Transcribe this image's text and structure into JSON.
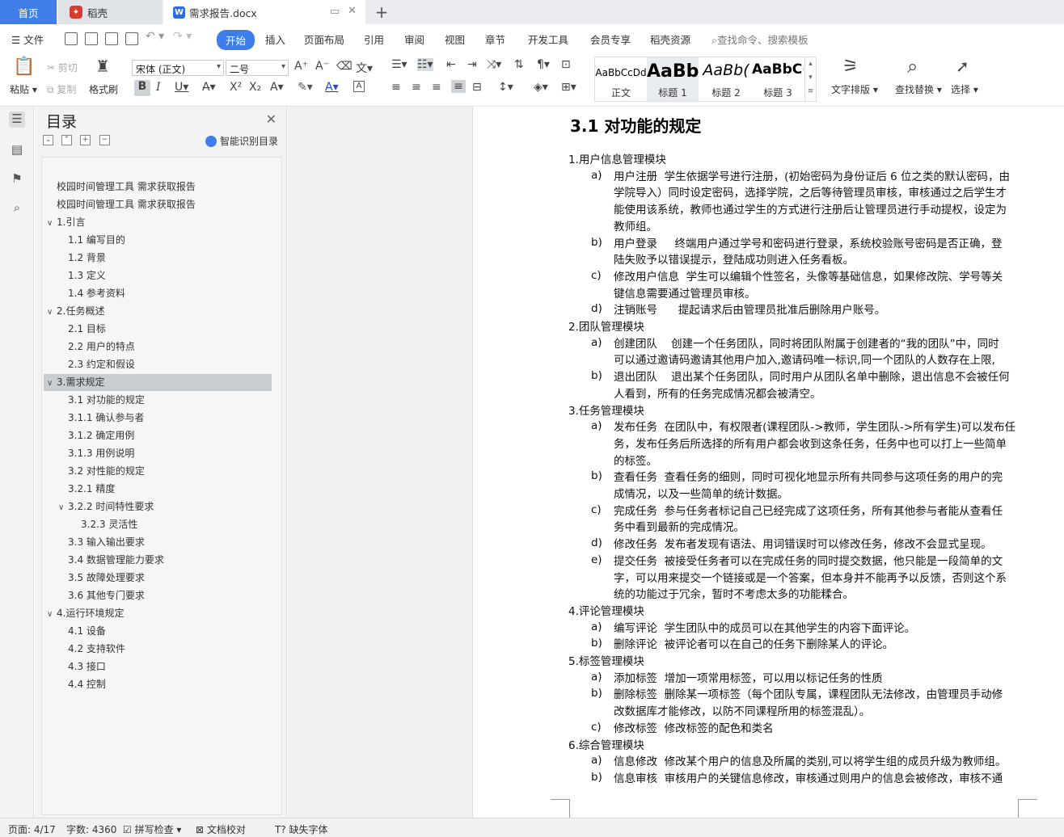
{
  "tabs": {
    "home": "首页",
    "daoke": "稻壳",
    "doc": "需求报告.docx",
    "add": "+"
  },
  "menu": {
    "file": "文件",
    "items": [
      "开始",
      "插入",
      "页面布局",
      "引用",
      "审阅",
      "视图",
      "章节",
      "开发工具",
      "会员专享",
      "稻壳资源"
    ],
    "search_placeholder": "查找命令、搜索模板"
  },
  "ribbon": {
    "paste": "粘贴",
    "cut": "剪切",
    "copy": "复制",
    "format_painter": "格式刷",
    "font_name": "宋体 (正文)",
    "font_size": "二号",
    "styles": [
      {
        "preview": "AaBbCcDd",
        "label": "正文"
      },
      {
        "preview": "AaBb",
        "label": "标题 1"
      },
      {
        "preview": "AaBb(",
        "label": "标题 2"
      },
      {
        "preview": "AaBbC(",
        "label": "标题 3"
      }
    ],
    "text_layout": "文字排版",
    "find_replace": "查找替换",
    "select": "选择"
  },
  "toc": {
    "title": "目录",
    "ai_label": "智能识别目录",
    "items": [
      {
        "text": "校园时间管理工具  需求获取报告",
        "level": 0,
        "caret": ""
      },
      {
        "text": "校园时间管理工具  需求获取报告",
        "level": 0,
        "caret": ""
      },
      {
        "text": "1.引言",
        "level": 0,
        "caret": "∨"
      },
      {
        "text": "1.1  编写目的",
        "level": 1,
        "caret": ""
      },
      {
        "text": "1.2  背景",
        "level": 1,
        "caret": ""
      },
      {
        "text": "1.3  定义",
        "level": 1,
        "caret": ""
      },
      {
        "text": "1.4  参考资料",
        "level": 1,
        "caret": ""
      },
      {
        "text": "2.任务概述",
        "level": 0,
        "caret": "∨"
      },
      {
        "text": "2.1  目标",
        "level": 1,
        "caret": ""
      },
      {
        "text": "2.2  用户的特点",
        "level": 1,
        "caret": ""
      },
      {
        "text": "2.3  约定和假设",
        "level": 1,
        "caret": ""
      },
      {
        "text": "3.需求规定",
        "level": 0,
        "caret": "∨",
        "selected": true
      },
      {
        "text": "3.1  对功能的规定",
        "level": 1,
        "caret": ""
      },
      {
        "text": "3.1.1  确认参与者",
        "level": 1,
        "caret": ""
      },
      {
        "text": "3.1.2  确定用例",
        "level": 1,
        "caret": ""
      },
      {
        "text": "3.1.3  用例说明",
        "level": 1,
        "caret": ""
      },
      {
        "text": "3.2  对性能的规定",
        "level": 1,
        "caret": ""
      },
      {
        "text": "3.2.1  精度",
        "level": 1,
        "caret": ""
      },
      {
        "text": "3.2.2  时间特性要求",
        "level": 1,
        "caret": "∨"
      },
      {
        "text": "3.2.3 灵活性",
        "level": 2,
        "caret": ""
      },
      {
        "text": "3.3 输入输出要求",
        "level": 1,
        "caret": ""
      },
      {
        "text": "3.4 数据管理能力要求",
        "level": 1,
        "caret": ""
      },
      {
        "text": "3.5 故障处理要求",
        "level": 1,
        "caret": ""
      },
      {
        "text": "3.6 其他专门要求",
        "level": 1,
        "caret": ""
      },
      {
        "text": "4.运行环境规定",
        "level": 0,
        "caret": "∨"
      },
      {
        "text": "4.1 设备",
        "level": 1,
        "caret": ""
      },
      {
        "text": "4.2  支持软件",
        "level": 1,
        "caret": ""
      },
      {
        "text": "4.3 接口",
        "level": 1,
        "caret": ""
      },
      {
        "text": "4.4 控制",
        "level": 1,
        "caret": ""
      }
    ]
  },
  "document": {
    "heading": "3.1  对功能的规定",
    "blocks": [
      {
        "type": "module",
        "text": "1.用户信息管理模块"
      },
      {
        "type": "item",
        "mark": "a)",
        "lines": [
          "用户注册  学生依据学号进行注册，(初始密码为身份证后 6 位之类的默认密码，由",
          "学院导入）同时设定密码，选择学院，之后等待管理员审核，审核通过之后学生才",
          "能使用该系统，教师也通过学生的方式进行注册后让管理员进行手动提权，设定为",
          "教师组。"
        ]
      },
      {
        "type": "item",
        "mark": "b)",
        "lines": [
          "用户登录     终端用户通过学号和密码进行登录，系统校验账号密码是否正确，登",
          "陆失败予以错误提示，登陆成功则进入任务看板。"
        ]
      },
      {
        "type": "item",
        "mark": "c)",
        "lines": [
          "修改用户信息  学生可以编辑个性签名，头像等基础信息，如果修改院、学号等关",
          "键信息需要通过管理员审核。"
        ]
      },
      {
        "type": "item",
        "mark": "d)",
        "lines": [
          "注销账号      提起请求后由管理员批准后删除用户账号。"
        ]
      },
      {
        "type": "module",
        "text": "2.团队管理模块"
      },
      {
        "type": "item",
        "mark": "a)",
        "lines": [
          "创建团队    创建一个任务团队，同时将团队附属于创建者的“我的团队”中，同时",
          "可以通过邀请码邀请其他用户加入,邀请码唯一标识,同一个团队的人数存在上限,"
        ]
      },
      {
        "type": "item",
        "mark": "b)",
        "lines": [
          "退出团队    退出某个任务团队，同时用户从团队名单中删除，退出信息不会被任何",
          "人看到，所有的任务完成情况都会被清空。"
        ]
      },
      {
        "type": "module",
        "text": "3.任务管理模块"
      },
      {
        "type": "item",
        "mark": "a)",
        "lines": [
          "发布任务  在团队中，有权限者(课程团队->教师，学生团队->所有学生)可以发布任",
          "务，发布任务后所选择的所有用户都会收到这条任务，任务中也可以打上一些简单",
          "的标签。"
        ]
      },
      {
        "type": "item",
        "mark": "b)",
        "lines": [
          "查看任务  查看任务的细则，同时可视化地显示所有共同参与这项任务的用户的完",
          "成情况，以及一些简单的统计数据。"
        ]
      },
      {
        "type": "item",
        "mark": "c)",
        "lines": [
          "完成任务  参与任务者标记自己已经完成了这项任务，所有其他参与者能从查看任",
          "务中看到最新的完成情况。"
        ]
      },
      {
        "type": "item",
        "mark": "d)",
        "lines": [
          "修改任务  发布者发现有语法、用词错误时可以修改任务，修改不会显式呈现。"
        ]
      },
      {
        "type": "item",
        "mark": "e)",
        "lines": [
          "提交任务  被接受任务者可以在完成任务的同时提交数据，他只能是一段简单的文",
          "字，可以用来提交一个链接或是一个答案，但本身并不能再予以反馈，否则这个系",
          "统的功能过于冗余，暂时不考虑太多的功能糅合。"
        ]
      },
      {
        "type": "module",
        "text": "4.评论管理模块"
      },
      {
        "type": "item",
        "mark": "a)",
        "lines": [
          "编写评论  学生团队中的成员可以在其他学生的内容下面评论。"
        ]
      },
      {
        "type": "item",
        "mark": "b)",
        "lines": [
          "删除评论  被评论者可以在自己的任务下删除某人的评论。"
        ]
      },
      {
        "type": "module",
        "text": "5.标签管理模块"
      },
      {
        "type": "item",
        "mark": "a)",
        "lines": [
          "添加标签  增加一项常用标签，可以用以标记任务的性质"
        ]
      },
      {
        "type": "item",
        "mark": "b)",
        "lines": [
          "删除标签  删除某一项标签（每个团队专属，课程团队无法修改，由管理员手动修",
          "改数据库才能修改，以防不同课程所用的标签混乱）。"
        ]
      },
      {
        "type": "item",
        "mark": "c)",
        "lines": [
          "修改标签  修改标签的配色和类名"
        ]
      },
      {
        "type": "module",
        "text": "6.综合管理模块"
      },
      {
        "type": "item",
        "mark": "a)",
        "lines": [
          "信息修改  修改某个用户的信息及所属的类别,可以将学生组的成员升级为教师组。"
        ]
      },
      {
        "type": "item",
        "mark": "b)",
        "lines": [
          "信息审核  审核用户的关键信息修改，审核通过则用户的信息会被修改，审核不通"
        ]
      }
    ]
  },
  "status": {
    "page": "页面: 4/17",
    "words": "字数: 4360",
    "spell": "拼写检查",
    "proof": "文档校对",
    "missing_font": "缺失字体"
  }
}
